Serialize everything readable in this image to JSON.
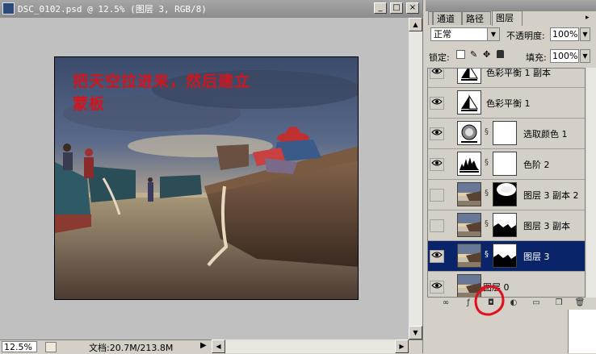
{
  "document": {
    "title": "DSC_0102.psd @ 12.5% (图层 3, RGB/8)",
    "minimize_glyph": "_",
    "maximize_glyph": "□",
    "close_glyph": "×",
    "zoom_level": "12.5%",
    "doc_size": "文档:20.7M/213.8M",
    "status_menu_glyph": "▶",
    "annotation": {
      "line1": "把天空拉进来，然后建立",
      "line2": "蒙板",
      "color": "#d4141c"
    }
  },
  "panel": {
    "tabs": [
      {
        "label": "通道",
        "active": false
      },
      {
        "label": "路径",
        "active": false
      },
      {
        "label": "图层",
        "active": true
      }
    ],
    "menu_glyph": "▸",
    "blend_mode": "正常",
    "dropdown_glyph": "▼",
    "opacity_label": "不透明度:",
    "opacity_value": "100%",
    "lock_label": "锁定:",
    "fill_label": "填充:",
    "fill_value": "100%",
    "layers": [
      {
        "name": "色彩平衡 1 副本",
        "visible": true,
        "type": "adjustment-balance",
        "selected": false
      },
      {
        "name": "色彩平衡 1",
        "visible": true,
        "type": "adjustment-balance",
        "selected": false
      },
      {
        "name": "选取颜色 1",
        "visible": true,
        "type": "adjustment-selective",
        "selected": false
      },
      {
        "name": "色阶 2",
        "visible": true,
        "type": "adjustment-levels",
        "selected": false
      },
      {
        "name": "图层 3 副本 2",
        "visible": false,
        "type": "image-mask-a",
        "selected": false
      },
      {
        "name": "图层 3 副本",
        "visible": false,
        "type": "image-mask-b",
        "selected": false
      },
      {
        "name": "图层 3",
        "visible": true,
        "type": "image-mask-c",
        "selected": true
      },
      {
        "name": "图层 0",
        "visible": true,
        "type": "image",
        "selected": false
      }
    ],
    "highlight_color": "#e0101c",
    "selection_color": "#0a246a"
  }
}
